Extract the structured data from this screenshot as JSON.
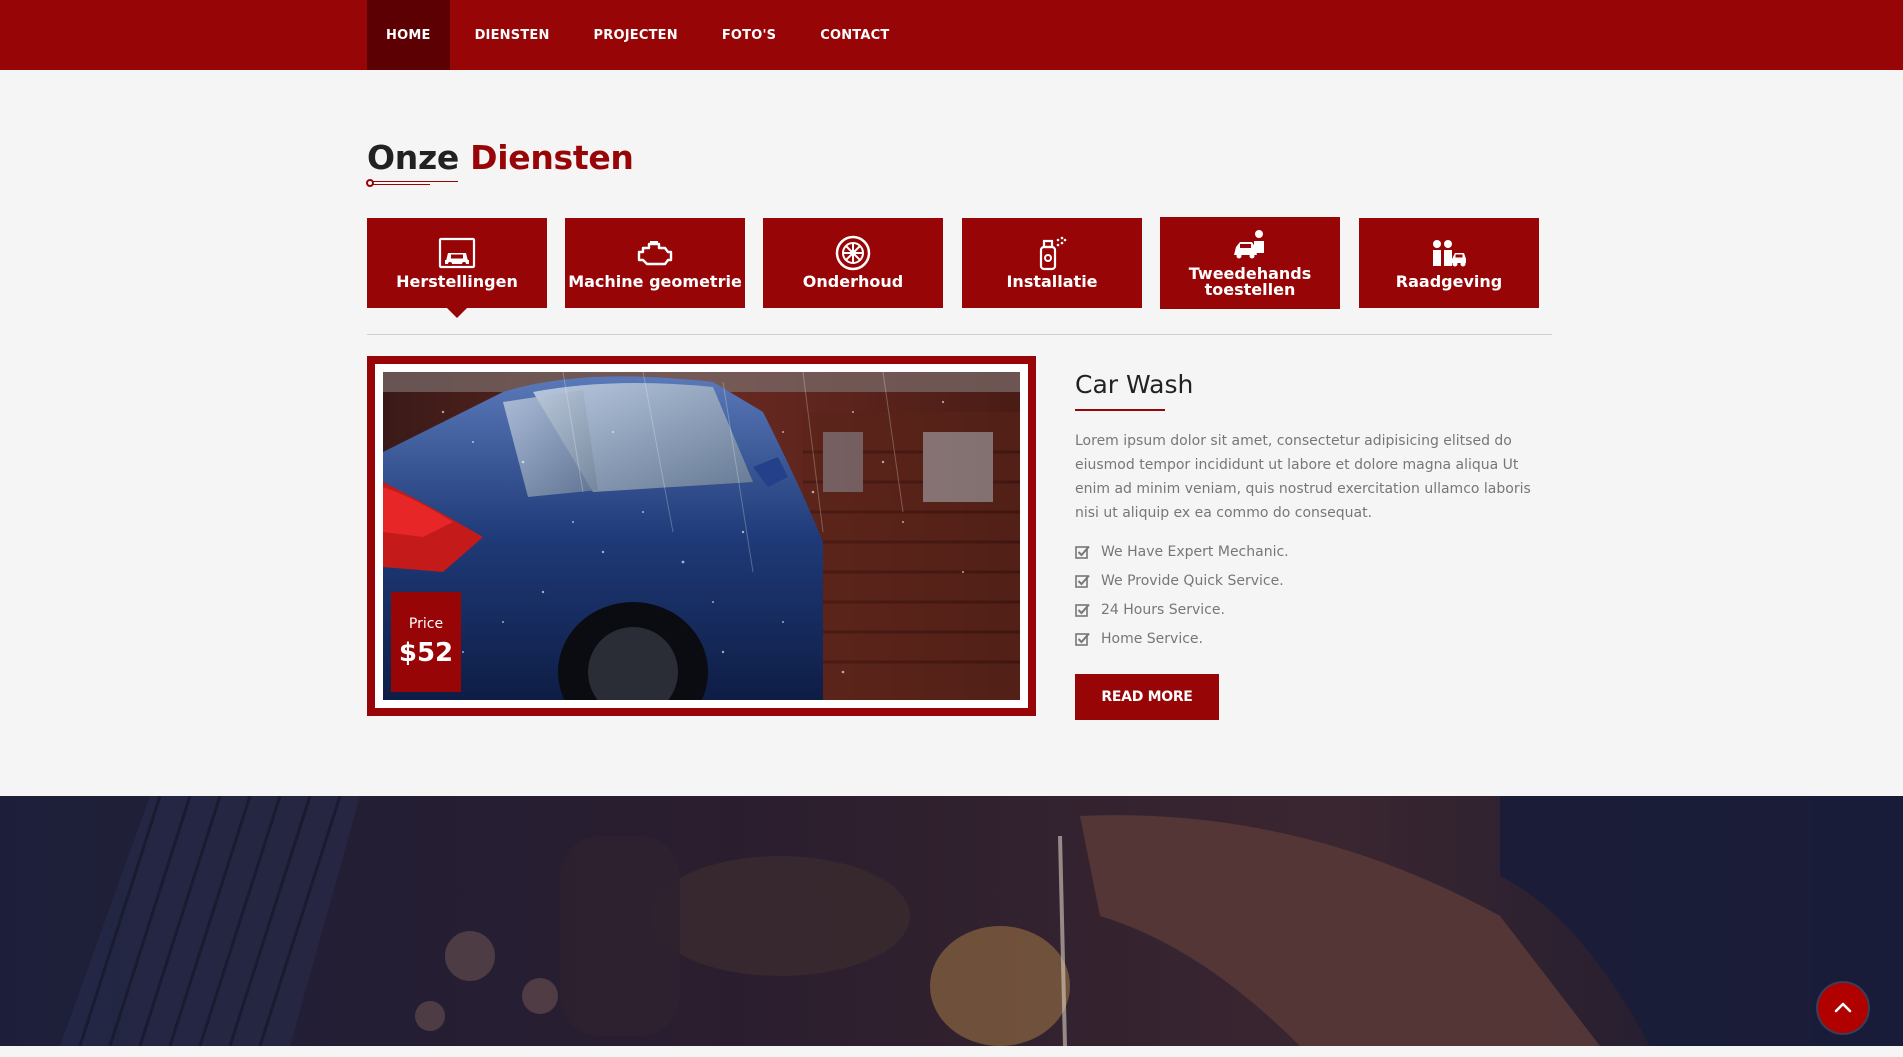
{
  "nav": {
    "items": [
      {
        "label": "HOME",
        "active": true
      },
      {
        "label": "DIENSTEN"
      },
      {
        "label": "PROJECTEN"
      },
      {
        "label": "FOTO'S"
      },
      {
        "label": "CONTACT"
      }
    ]
  },
  "section": {
    "title_part1": "Onze",
    "title_part2": "Diensten"
  },
  "tabs": [
    {
      "label": "Herstellingen",
      "icon": "car-lift-icon",
      "active": true
    },
    {
      "label": "Machine geometrie",
      "icon": "engine-icon"
    },
    {
      "label": "Onderhoud",
      "icon": "wheel-icon"
    },
    {
      "label": "Installatie",
      "icon": "spray-bottle-icon"
    },
    {
      "label": "Tweedehands toestellen",
      "icon": "car-person-icon"
    },
    {
      "label": "Raadgeving",
      "icon": "consultation-icon"
    }
  ],
  "service": {
    "price_label": "Price",
    "price_value": "$52",
    "title": "Car Wash",
    "description": "Lorem ipsum dolor sit amet, consectetur adipisicing elitsed do eiusmod tempor incididunt ut labore et dolore magna aliqua Ut enim ad minim veniam, quis nostrud exercitation ullamco laboris nisi ut aliquip ex ea commo do consequat.",
    "features": [
      "We Have Expert Mechanic.",
      "We Provide Quick Service.",
      "24 Hours Service.",
      "Home Service."
    ],
    "read_more": "READ MORE"
  },
  "colors": {
    "accent": "#980507",
    "accent_dark": "#5d0003",
    "background": "#f5f5f5"
  }
}
